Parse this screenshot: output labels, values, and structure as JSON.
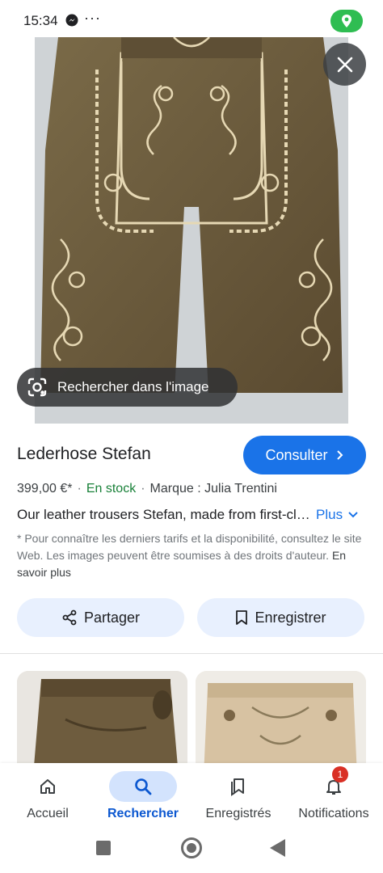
{
  "status_bar": {
    "time": "15:34",
    "dots": "···"
  },
  "image": {
    "lens_label": "Rechercher dans l'image"
  },
  "product": {
    "title": "Lederhose Stefan",
    "consult_label": "Consulter",
    "price": "399,00 €*",
    "stock": "En stock",
    "brand": "Marque : Julia Trentini",
    "description": "Our leather trousers Stefan, made from first-class",
    "more_label": "Plus",
    "disclaimer": "* Pour connaître les derniers tarifs et la disponibilité, consultez le site Web. Les images peuvent être soumises à des droits d'auteur.",
    "disclaimer_link": "En savoir plus"
  },
  "actions": {
    "share_label": "Partager",
    "save_label": "Enregistrer"
  },
  "bottom_nav": {
    "items": [
      {
        "label": "Accueil",
        "icon": "home-icon"
      },
      {
        "label": "Rechercher",
        "icon": "search-icon"
      },
      {
        "label": "Enregistrés",
        "icon": "bookmark-icon"
      },
      {
        "label": "Notifications",
        "icon": "bell-icon",
        "badge": "1"
      }
    ]
  },
  "colors": {
    "accent": "#1a73e8",
    "stock": "#188038",
    "location_pill": "#2fbd52",
    "badge": "#d93025"
  }
}
